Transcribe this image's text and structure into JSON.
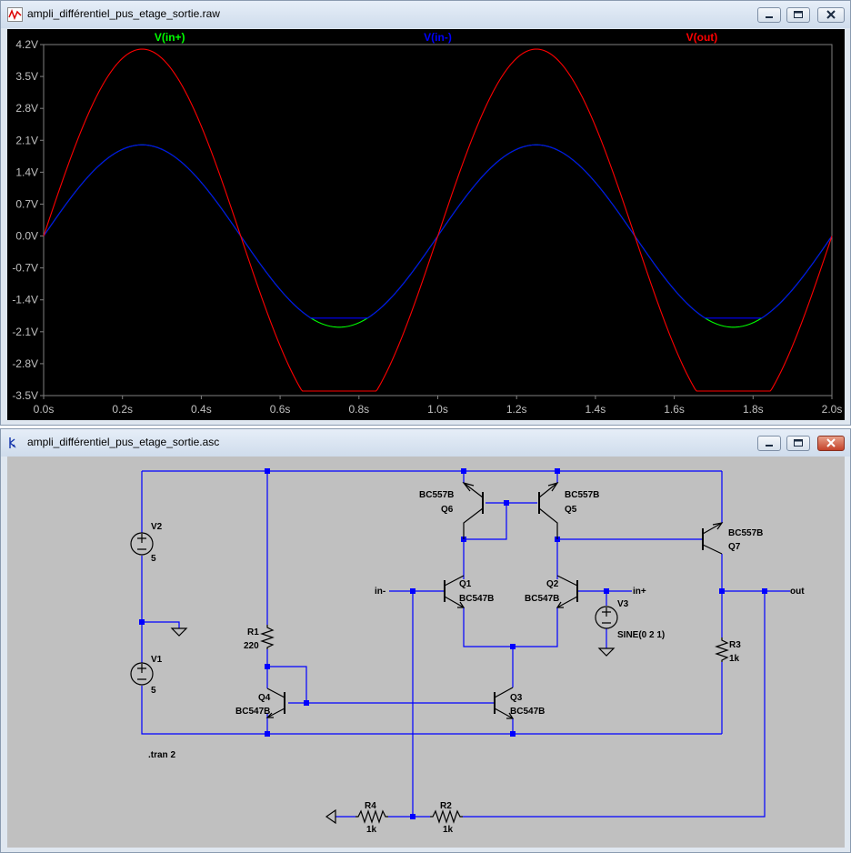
{
  "waveform_window": {
    "title": "ampli_différentiel_pus_etage_sortie.raw",
    "colors": {
      "grid_axis": "#808080",
      "label": "#c0c0c0"
    }
  },
  "chart_data": {
    "type": "line",
    "xlabel": "",
    "ylabel": "",
    "xlim": [
      0,
      2.0
    ],
    "ylim": [
      -3.5,
      4.2
    ],
    "x_ticks": [
      "0.0s",
      "0.2s",
      "0.4s",
      "0.6s",
      "0.8s",
      "1.0s",
      "1.2s",
      "1.4s",
      "1.6s",
      "1.8s",
      "2.0s"
    ],
    "y_ticks": [
      "4.2V",
      "3.5V",
      "2.8V",
      "2.1V",
      "1.4V",
      "0.7V",
      "0.0V",
      "-0.7V",
      "-1.4V",
      "-2.1V",
      "-2.8V",
      "-3.5V"
    ],
    "grid": false,
    "legend_position": "top",
    "series": [
      {
        "name": "V(in+)",
        "color": "#00ff00",
        "amplitude": 2.0,
        "frequency_hz": 1,
        "clip_low": null,
        "clip_high": null
      },
      {
        "name": "V(in-)",
        "color": "#0000ff",
        "amplitude": 2.0,
        "frequency_hz": 1,
        "clip_low": -1.8,
        "clip_high": null
      },
      {
        "name": "V(out)",
        "color": "#ff0000",
        "amplitude": 4.1,
        "frequency_hz": 1,
        "clip_low": -3.4,
        "clip_high": null
      }
    ]
  },
  "schematic_window": {
    "title": "ampli_différentiel_pus_etage_sortie.asc",
    "labels": {
      "v2": "V2",
      "v2_val": "5",
      "v1": "V1",
      "v1_val": "5",
      "r1": "R1",
      "r1_val": "220",
      "q4": "Q4",
      "q4_model": "BC547B",
      "q3": "Q3",
      "q3_model": "BC547B",
      "q1": "Q1",
      "q1_model": "BC547B",
      "q2": "Q2",
      "q2_model": "BC547B",
      "q6": "Q6",
      "q6_model": "BC557B",
      "q5": "Q5",
      "q5_model": "BC557B",
      "q7": "Q7",
      "q7_model": "BC557B",
      "v3": "V3",
      "v3_val": "SINE(0 2 1)",
      "r3": "R3",
      "r3_val": "1k",
      "r4": "R4",
      "r4_val": "1k",
      "r2": "R2",
      "r2_val": "1k",
      "in_minus": "in-",
      "in_plus": "in+",
      "out": "out",
      "tran": ".tran 2"
    },
    "colors": {
      "wire": "#0000ff",
      "component": "#000000",
      "background": "#c0c0c0"
    }
  }
}
